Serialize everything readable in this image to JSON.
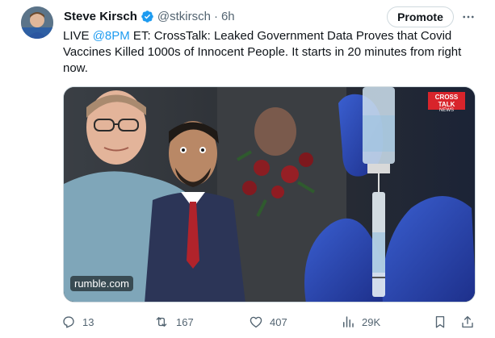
{
  "author": {
    "display_name": "Steve Kirsch",
    "handle": "@stkirsch",
    "separator": "·",
    "time": "6h"
  },
  "header": {
    "promote_label": "Promote"
  },
  "tweet": {
    "text_before": "LIVE ",
    "mention": "@8PM",
    "text_after": " ET: CrossTalk: Leaked Government Data Proves that Covid Vaccines Killed 1000s of Innocent People. It starts in 20 minutes from right now."
  },
  "media": {
    "watermark": "rumble.com",
    "badge_line1": "CROSS",
    "badge_line2": "TALK",
    "badge_line3": "NEWS"
  },
  "actions": {
    "replies": "13",
    "reposts": "167",
    "likes": "407",
    "views": "29K"
  },
  "colors": {
    "accent": "#1d9bf0",
    "verified": "#1d9bf0",
    "muted": "#536471"
  },
  "icons": {
    "verified": "verified-badge-icon",
    "more": "more-dots-icon",
    "reply": "reply-icon",
    "repost": "repost-icon",
    "like": "heart-icon",
    "views": "views-icon",
    "bookmark": "bookmark-icon",
    "share": "share-icon"
  }
}
